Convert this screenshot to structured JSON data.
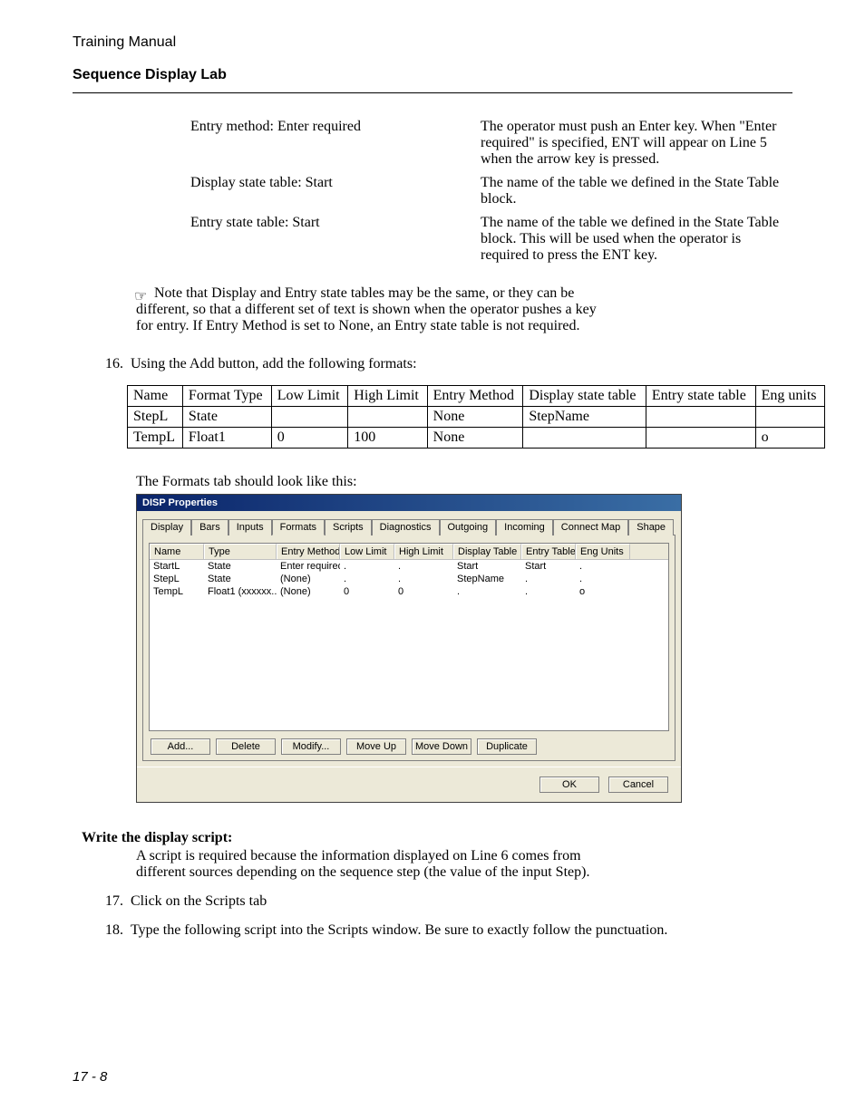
{
  "header": {
    "manual": "Training Manual",
    "lab": "Sequence Display Lab"
  },
  "pairs": [
    {
      "left": "Entry method:  Enter required",
      "right": "The operator must push an Enter key. When \"Enter required\" is specified, ENT will appear on Line 5 when the arrow key is pressed."
    },
    {
      "left": "Display state table:  Start",
      "right": "The name of the table we defined in the State Table block."
    },
    {
      "left": "Entry state table:  Start",
      "right": "The name of the table we defined in the State Table block.  This will be used when the operator is required to press the ENT key."
    }
  ],
  "note_icon": "☞",
  "note": "Note that Display and Entry state tables may be the same, or they can be different, so that a different set of text is shown when the operator pushes a key for entry.  If Entry Method is set to None, an Entry state table is not required.",
  "step16": {
    "num": "16.",
    "text": "Using the Add button, add the following formats:"
  },
  "table": {
    "headers": [
      "Name",
      "Format Type",
      "Low Limit",
      "High Limit",
      "Entry Method",
      "Display state table",
      "Entry state table",
      "Eng units"
    ],
    "rows": [
      [
        "StepL",
        "State",
        "",
        "",
        "None",
        "StepName",
        "",
        ""
      ],
      [
        "TempL",
        "Float1",
        "0",
        "100",
        "None",
        "",
        "",
        "o"
      ]
    ]
  },
  "tab_caption": "The Formats tab should look like this:",
  "dialog": {
    "title": "DISP Properties",
    "tabs": [
      "Display",
      "Bars",
      "Inputs",
      "Formats",
      "Scripts",
      "Diagnostics",
      "Outgoing",
      "Incoming",
      "Connect Map",
      "Shape"
    ],
    "active_tab_index": 3,
    "list_headers": [
      "Name",
      "Type",
      "Entry Method",
      "Low Limit",
      "High Limit",
      "Display Table",
      "Entry Table",
      "Eng Units"
    ],
    "list_rows": [
      [
        "StartL",
        "State",
        "Enter required",
        ".",
        ".",
        "Start",
        "Start",
        "."
      ],
      [
        "StepL",
        "State",
        "(None)",
        ".",
        ".",
        "StepName",
        ".",
        "."
      ],
      [
        "TempL",
        "Float1 (xxxxxx...",
        "(None)",
        "0",
        "0",
        ".",
        ".",
        "o"
      ]
    ],
    "buttons": [
      "Add...",
      "Delete",
      "Modify...",
      "Move Up",
      "Move Down",
      "Duplicate"
    ],
    "ok": "OK",
    "cancel": "Cancel"
  },
  "write_script_head": "Write the display script:",
  "write_script_body": "A script is required because the information displayed on Line 6 comes from different sources depending on the sequence step (the value of the input Step).",
  "step17": {
    "num": "17.",
    "text": "Click on the Scripts tab"
  },
  "step18": {
    "num": "18.",
    "text": "Type the following script into the Scripts window.  Be sure to exactly follow the punctuation."
  },
  "page_number": "17 - 8"
}
